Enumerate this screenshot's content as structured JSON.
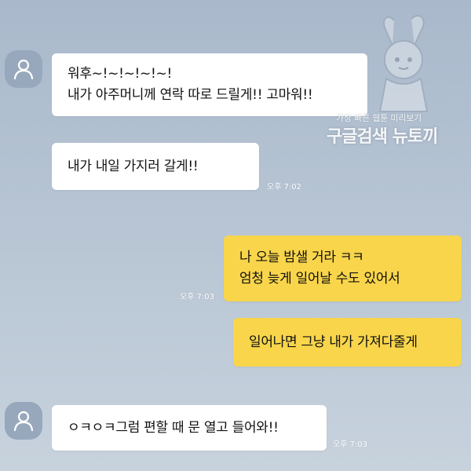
{
  "watermark": {
    "line1": "가장 빠른 웹툰 미리보기",
    "line2": "구글검색 뉴토끼"
  },
  "messages": [
    {
      "sender": "other",
      "lines": [
        "워후~!~!~!~!~!",
        "내가 아주머니께 연락 따로 드릴게!! 고마워!!"
      ],
      "time": ""
    },
    {
      "sender": "other",
      "lines": [
        "내가 내일 가지러 갈게!!"
      ],
      "time": "오후 7:02"
    },
    {
      "sender": "me",
      "lines": [
        "나 오늘 밤샐 거라 ㅋㅋ",
        "엄청 늦게 일어날 수도 있어서"
      ],
      "time": "오후 7:03"
    },
    {
      "sender": "me",
      "lines": [
        "일어나면 그냥 내가 가져다줄게"
      ],
      "time": ""
    },
    {
      "sender": "other",
      "lines": [
        "ㅇㅋㅇㅋ그럼 편할 때 문 열고 들어와!!"
      ],
      "time": "오후 7:03"
    }
  ],
  "icons": {
    "avatar": "person-icon"
  }
}
